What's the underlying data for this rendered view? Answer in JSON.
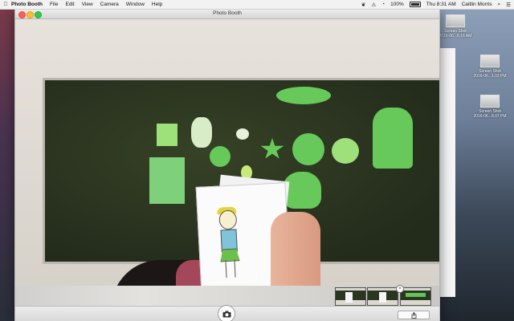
{
  "menubar": {
    "apple": "",
    "app_name": "Photo Booth",
    "items": [
      "File",
      "Edit",
      "View",
      "Camera",
      "Window",
      "Help"
    ],
    "battery": "100%",
    "clock": "Thu 8:31 AM",
    "user": "Caitlin Morris"
  },
  "window": {
    "title": "Photo Booth"
  },
  "desktop_icons": [
    {
      "name": "Screen Shot",
      "date": "2016-06...8.16 AM"
    },
    {
      "name": "Screen Shot",
      "date": "2016-06...1.03 PM"
    },
    {
      "name": "Screen Shot",
      "date": "2016-06...8.07 PM"
    }
  ],
  "filmstrip": {
    "close_glyph": "×"
  }
}
